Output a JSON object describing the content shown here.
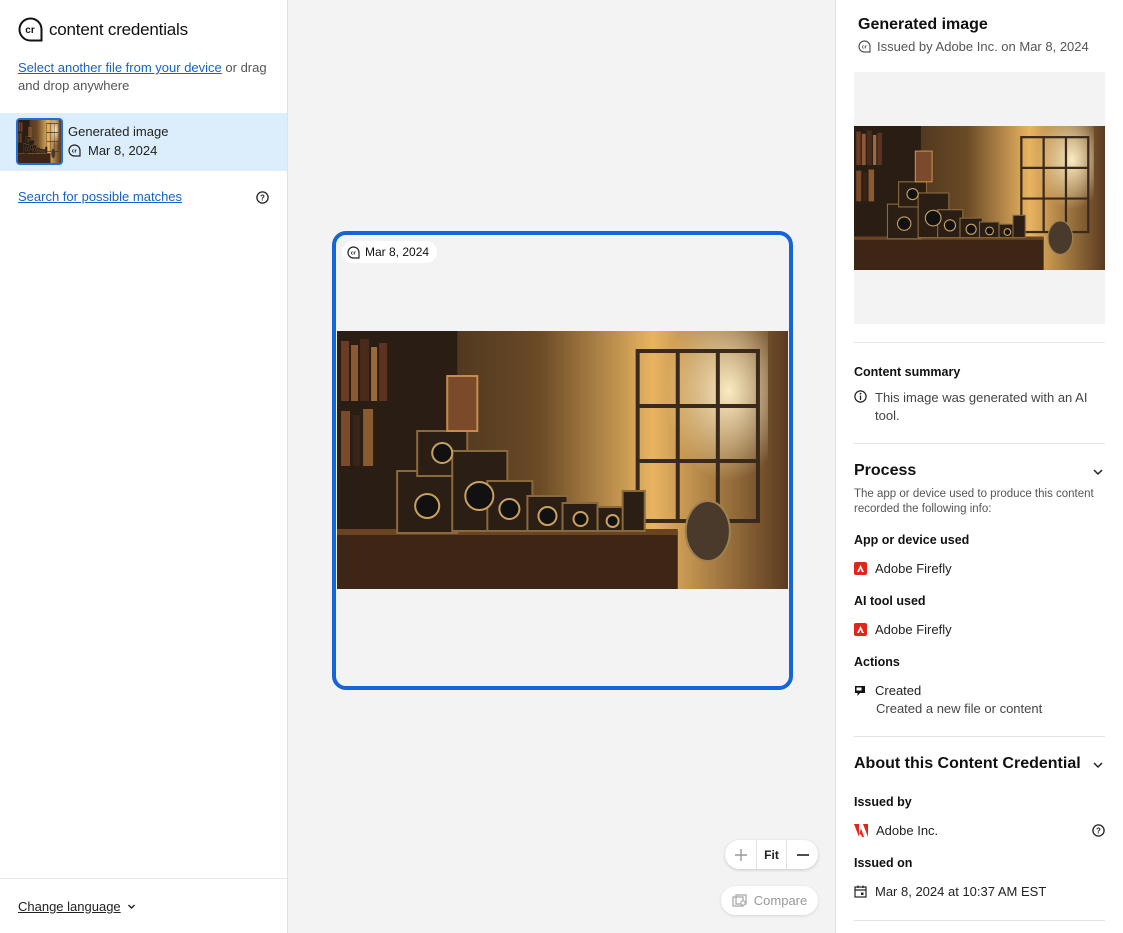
{
  "sidebar": {
    "brand": "content credentials",
    "upload_link": "Select another file from your device",
    "upload_rest": " or drag and drop anywhere",
    "file": {
      "name": "Generated image",
      "date": "Mar 8, 2024"
    },
    "search_link": "Search for possible matches",
    "language": "Change language"
  },
  "canvas": {
    "date_chip": "Mar 8, 2024",
    "zoom_fit": "Fit",
    "compare": "Compare"
  },
  "panel": {
    "title": "Generated image",
    "issued": "Issued by Adobe Inc. on Mar 8, 2024",
    "summary_heading": "Content summary",
    "summary_text": "This image was generated with an AI tool.",
    "process_heading": "Process",
    "process_desc": "The app or device used to produce this content recorded the following info:",
    "app_heading": "App or device used",
    "app_value": "Adobe Firefly",
    "ai_heading": "AI tool used",
    "ai_value": "Adobe Firefly",
    "actions_heading": "Actions",
    "action_name": "Created",
    "action_desc": "Created a new file or content",
    "about_heading": "About this Content Credential",
    "issued_by_heading": "Issued by",
    "issued_by_value": "Adobe Inc.",
    "issued_on_heading": "Issued on",
    "issued_on_value": "Mar 8, 2024 at 10:37 AM EST"
  },
  "colors": {
    "accent": "#1565d8",
    "link": "#1463c9",
    "selected_row": "#dcedfb",
    "adobe_red": "#e1251b"
  },
  "icons": [
    "cr-logo-icon",
    "cr-badge-icon",
    "help-icon",
    "chevron-down-icon",
    "info-icon",
    "adobe-firefly-icon",
    "adobe-logo-icon",
    "created-action-icon",
    "calendar-icon",
    "plus-icon",
    "minus-icon",
    "compare-icon"
  ]
}
